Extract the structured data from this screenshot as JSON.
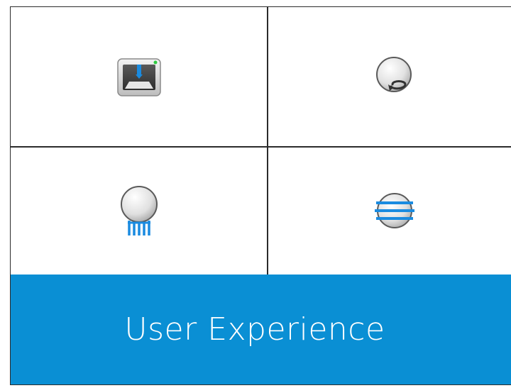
{
  "banner": {
    "title": "User Experience",
    "background_color": "#0a8fd4"
  },
  "tiles": [
    {
      "icon": "3d-printer-icon"
    },
    {
      "icon": "rotate-view-icon"
    },
    {
      "icon": "support-sphere-icon"
    },
    {
      "icon": "slice-layers-icon"
    }
  ],
  "colors": {
    "accent_blue": "#1a8be0",
    "indicator_green": "#2ecc40",
    "grid_line": "#2b2b2b"
  }
}
